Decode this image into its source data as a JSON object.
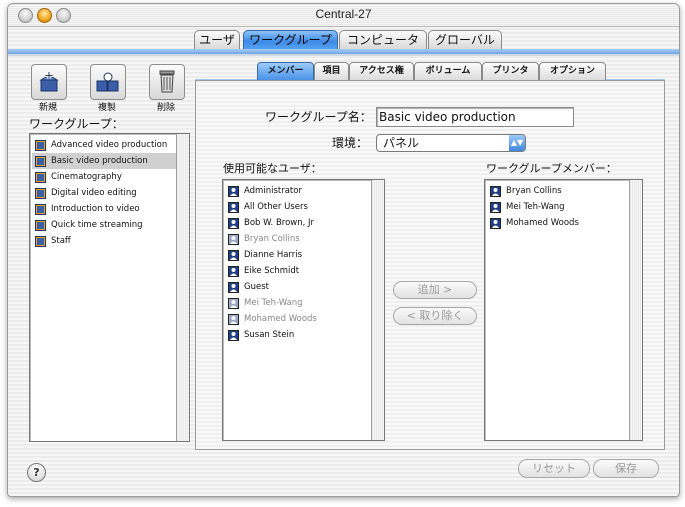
{
  "window": {
    "title": "Central-27"
  },
  "top_tabs": [
    {
      "label": "ユーザ",
      "selected": false
    },
    {
      "label": "ワークグループ",
      "selected": true
    },
    {
      "label": "コンピュータ",
      "selected": false
    },
    {
      "label": "グローバル",
      "selected": false
    }
  ],
  "toolbar": {
    "new_label": "新規",
    "duplicate_label": "複製",
    "delete_label": "削除"
  },
  "sidebar": {
    "heading": "ワークグループ：",
    "items": [
      {
        "label": "Advanced video production",
        "icon": "workgroup-icon",
        "selected": false
      },
      {
        "label": "Basic video production",
        "icon": "workgroup-icon",
        "selected": true
      },
      {
        "label": "Cinematography",
        "icon": "workgroup-icon",
        "selected": false
      },
      {
        "label": "Digital video editing",
        "icon": "workgroup-icon",
        "selected": false
      },
      {
        "label": "Introduction to video",
        "icon": "workgroup-icon",
        "selected": false
      },
      {
        "label": "Quick time streaming",
        "icon": "workgroup-icon",
        "selected": false
      },
      {
        "label": "Staff",
        "icon": "workgroup-icon",
        "selected": false
      }
    ]
  },
  "sub_tabs": [
    {
      "label": "メンバー",
      "selected": true
    },
    {
      "label": "項目",
      "selected": false
    },
    {
      "label": "アクセス権",
      "selected": false
    },
    {
      "label": "ボリューム",
      "selected": false
    },
    {
      "label": "プリンタ",
      "selected": false
    },
    {
      "label": "オプション",
      "selected": false
    }
  ],
  "form": {
    "name_label": "ワークグループ名：",
    "name_value": "Basic video production",
    "env_label": "環境：",
    "env_value": "パネル"
  },
  "available_users": {
    "heading": "使用可能なユーザ：",
    "items": [
      {
        "label": "Administrator",
        "dim": false
      },
      {
        "label": "All Other Users",
        "dim": false
      },
      {
        "label": "Bob W. Brown, Jr",
        "dim": false
      },
      {
        "label": "Bryan Collins",
        "dim": true
      },
      {
        "label": "Dianne Harris",
        "dim": false
      },
      {
        "label": "Eike Schmidt",
        "dim": false
      },
      {
        "label": "Guest",
        "dim": false
      },
      {
        "label": "Mei Teh-Wang",
        "dim": true
      },
      {
        "label": "Mohamed Woods",
        "dim": true
      },
      {
        "label": "Susan Stein",
        "dim": false
      }
    ]
  },
  "members": {
    "heading": "ワークグループメンバー：",
    "items": [
      {
        "label": "Bryan Collins"
      },
      {
        "label": "Mei Teh-Wang"
      },
      {
        "label": "Mohamed Woods"
      }
    ]
  },
  "buttons": {
    "add_label": "追加 >",
    "remove_label": "< 取り除く",
    "reset_label": "リセット",
    "save_label": "保存",
    "help_label": "?"
  },
  "colors": {
    "accent": "#3c8ae6",
    "selection": "#d0d0d0"
  }
}
